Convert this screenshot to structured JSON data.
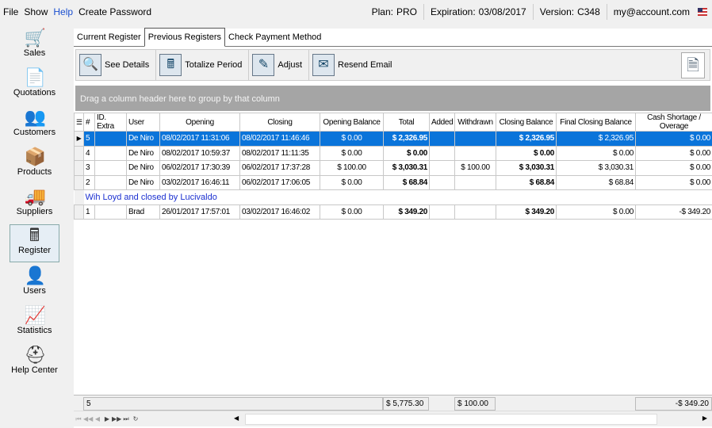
{
  "menu": {
    "items": [
      "File",
      "Show",
      "Help",
      "Create Password"
    ]
  },
  "account": {
    "plan_label": "Plan:",
    "plan": "PRO",
    "expiration_label": "Expiration:",
    "expiration": "03/08/2017",
    "version_label": "Version:",
    "version": "C348",
    "email": "my@account.com",
    "flag_icon": "us-flag-icon"
  },
  "sidebar": {
    "items": [
      {
        "label": "Sales",
        "icon": "🛒"
      },
      {
        "label": "Quotations",
        "icon": "📄"
      },
      {
        "label": "Customers",
        "icon": "👥"
      },
      {
        "label": "Products",
        "icon": "📦"
      },
      {
        "label": "Suppliers",
        "icon": "🚚"
      },
      {
        "label": "Register",
        "icon": "🖩",
        "selected": true
      },
      {
        "label": "Users",
        "icon": "👤"
      },
      {
        "label": "Statistics",
        "icon": "📈"
      },
      {
        "label": "Help Center",
        "icon": "⛑"
      }
    ]
  },
  "tabs": [
    {
      "label": "Current Register"
    },
    {
      "label": "Previous Registers",
      "active": true
    },
    {
      "label": "Check Payment Method"
    }
  ],
  "toolbar": {
    "see_details": "See Details",
    "totalize_period": "Totalize Period",
    "adjust": "Adjust",
    "resend_email": "Resend Email"
  },
  "group_hint": "Drag a column header here to group by that column",
  "columns": [
    "#",
    "ID. Extra",
    "User",
    "Opening",
    "Closing",
    "Opening Balance",
    "Total",
    "Added",
    "Withdrawn",
    "Closing Balance",
    "Final Closing Balance",
    "Cash Shortage / Overage"
  ],
  "rows": [
    [
      "5",
      "",
      "De Niro",
      "08/02/2017 11:31:06",
      "08/02/2017 11:46:46",
      "$ 0.00",
      "$ 2,326.95",
      "",
      "",
      "$ 2,326.95",
      "$ 2,326.95",
      "$ 0.00"
    ],
    [
      "4",
      "",
      "De Niro",
      "08/02/2017 10:59:37",
      "08/02/2017 11:11:35",
      "$ 0.00",
      "$ 0.00",
      "",
      "",
      "$ 0.00",
      "$ 0.00",
      "$ 0.00"
    ],
    [
      "3",
      "",
      "De Niro",
      "06/02/2017 17:30:39",
      "06/02/2017 17:37:28",
      "$ 100.00",
      "$ 3,030.31",
      "",
      "$ 100.00",
      "$ 3,030.31",
      "$ 3,030.31",
      "$ 0.00"
    ],
    [
      "2",
      "",
      "De Niro",
      "03/02/2017 16:46:11",
      "06/02/2017 17:06:05",
      "$ 0.00",
      "$ 68.84",
      "",
      "",
      "$ 68.84",
      "$ 68.84",
      "$ 0.00"
    ],
    {
      "note": "Wih Loyd and closed by Lucivaldo"
    },
    [
      "1",
      "",
      "Brad",
      "26/01/2017 17:57:01",
      "03/02/2017 16:46:02",
      "$ 0.00",
      "$ 349.20",
      "",
      "",
      "$ 349.20",
      "$ 0.00",
      "-$ 349.20"
    ]
  ],
  "selected_row": 0,
  "footer": {
    "count": "5",
    "total": "$ 5,775.30",
    "withdrawn": "$ 100.00",
    "cash_shortage": "-$ 349.20"
  }
}
